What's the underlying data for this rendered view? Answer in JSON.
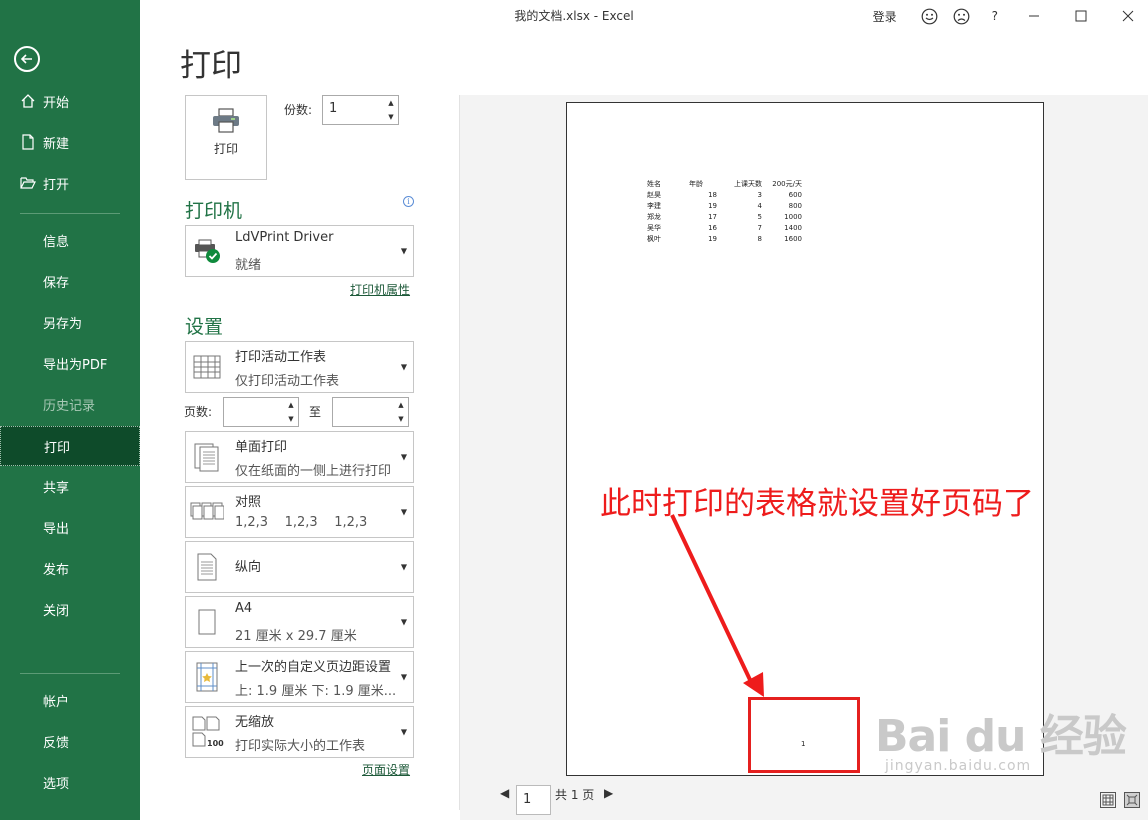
{
  "window": {
    "title": "我的文档.xlsx  -  Excel",
    "login": "登录",
    "help": "?"
  },
  "sidebar": {
    "items": [
      {
        "label": "开始",
        "icon": "home-icon"
      },
      {
        "label": "新建",
        "icon": "new-file-icon"
      },
      {
        "label": "打开",
        "icon": "open-folder-icon"
      },
      {
        "label": "信息"
      },
      {
        "label": "保存"
      },
      {
        "label": "另存为"
      },
      {
        "label": "导出为PDF"
      },
      {
        "label": "历史记录"
      },
      {
        "label": "打印"
      },
      {
        "label": "共享"
      },
      {
        "label": "导出"
      },
      {
        "label": "发布"
      },
      {
        "label": "关闭"
      },
      {
        "label": "帐户"
      },
      {
        "label": "反馈"
      },
      {
        "label": "选项"
      }
    ],
    "active": "打印"
  },
  "print": {
    "title": "打印",
    "button_label": "打印",
    "copies_label": "份数:",
    "copies_value": "1",
    "printer_section": "打印机",
    "printer_name": "LdVPrint Driver",
    "printer_status": "就绪",
    "printer_properties": "打印机属性",
    "settings_section": "设置",
    "settings": [
      {
        "l1": "打印活动工作表",
        "l2": "仅打印活动工作表"
      },
      {
        "l1": "单面打印",
        "l2": "仅在纸面的一侧上进行打印"
      },
      {
        "l1": "对照",
        "l2": "1,2,3    1,2,3    1,2,3"
      },
      {
        "l1": "纵向"
      },
      {
        "l1": "A4",
        "l2": "21 厘米 x 29.7 厘米"
      },
      {
        "l1": "上一次的自定义页边距设置",
        "l2": "上: 1.9 厘米 下: 1.9 厘米..."
      },
      {
        "l1": "无缩放",
        "l2": "打印实际大小的工作表"
      }
    ],
    "pages_label": "页数:",
    "to_label": "至",
    "page_setup": "页面设置"
  },
  "preview": {
    "sheet_header": [
      "姓名",
      "年龄",
      "上课天数",
      "200元/天"
    ],
    "sheet_rows": [
      [
        "赵昊",
        "18",
        "3",
        "600"
      ],
      [
        "李建",
        "19",
        "4",
        "800"
      ],
      [
        "郑龙",
        "17",
        "5",
        "1000"
      ],
      [
        "吴华",
        "16",
        "7",
        "1400"
      ],
      [
        "枫叶",
        "19",
        "8",
        "1600"
      ]
    ],
    "page_number": "1",
    "annotation": "此时打印的表格就设置好页码了",
    "current_page": "1",
    "total_pages": "共 1 页"
  },
  "watermark": {
    "logo": "Bai du 经验",
    "url": "jingyan.baidu.com"
  },
  "colors": {
    "sidebar": "#217346",
    "sidebar_active": "#0e4b2a",
    "annotation": "#ee1c1c"
  }
}
